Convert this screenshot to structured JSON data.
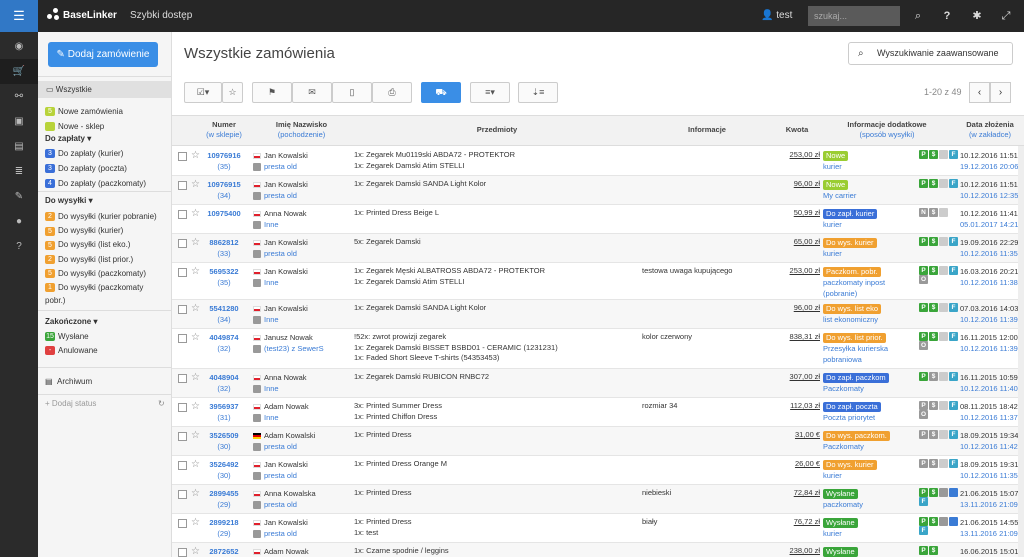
{
  "topbar": {
    "app_name": "BaseLinker",
    "quick_access": "Szybki dostęp",
    "user": "test",
    "search_placeholder": "szukaj...",
    "icons": [
      "search-icon",
      "help-icon",
      "settings-icon",
      "fullscreen-icon",
      "logout-icon"
    ]
  },
  "iconbar": [
    "dashboard-icon",
    "cart-icon",
    "link-icon",
    "storage-icon",
    "store-icon",
    "database-icon",
    "integrations-icon",
    "user-icon",
    "help-icon"
  ],
  "sidebar": {
    "add_button": "Dodaj zamówienie",
    "all": "Wszystkie",
    "group1": [
      {
        "label": "Nowe zamówienia",
        "count": "5",
        "color": "#b8d33a"
      },
      {
        "label": "Nowe - sklep",
        "count": "",
        "color": "#b8d33a"
      }
    ],
    "group_pay": {
      "title": "Do zapłaty ▾",
      "items": [
        {
          "label": "Do zapłaty (kurier)",
          "count": "3",
          "color": "#3a6fd8"
        },
        {
          "label": "Do zapłaty (poczta)",
          "count": "3",
          "color": "#3a6fd8"
        },
        {
          "label": "Do zapłaty (paczkomaty)",
          "count": "4",
          "color": "#3a6fd8"
        }
      ]
    },
    "group_ship": {
      "title": "Do wysyłki ▾",
      "items": [
        {
          "label": "Do wysyłki (kurier pobranie)",
          "count": "2",
          "color": "#f0a030"
        },
        {
          "label": "Do wysyłki (kurier)",
          "count": "5",
          "color": "#f0a030"
        },
        {
          "label": "Do wysyłki (list eko.)",
          "count": "5",
          "color": "#f0a030"
        },
        {
          "label": "Do wysyłki (list prior.)",
          "count": "2",
          "color": "#f0a030"
        },
        {
          "label": "Do wysyłki (paczkomaty)",
          "count": "5",
          "color": "#f0a030"
        },
        {
          "label": "Do wysyłki (paczkomaty",
          "label2": "pobr.)",
          "count": "1",
          "color": "#f0a030"
        }
      ]
    },
    "group_done": {
      "title": "Zakończone ▾",
      "items": [
        {
          "label": "Wysłane",
          "count": "15",
          "color": "#3aa53a"
        },
        {
          "label": "Anulowane",
          "count": "-",
          "color": "#e04040"
        }
      ]
    },
    "archive": "Archiwum",
    "add_status": "+ Dodaj status"
  },
  "main": {
    "title": "Wszystkie zamówienia",
    "adv_search": "Wyszukiwanie zaawansowane",
    "pager": "1-20 z 49",
    "columns": {
      "number": "Numer",
      "number_sub": "(w sklepie)",
      "name": "Imię Nazwisko",
      "name_sub": "(pochodzenie)",
      "products": "Przedmioty",
      "info": "Informacje",
      "amount": "Kwota",
      "extra": "Informacje dodatkowe",
      "extra_sub": "(sposób wysyłki)",
      "date": "Data złożenia",
      "date_sub": "(w zakładce)"
    },
    "rows": [
      {
        "id": "10976916",
        "shop_id": "(35)",
        "flag": "pl",
        "name": "Jan Kowalski",
        "source": "presta old",
        "products": [
          "1x: Zegarek Mu0119ski ABDA72 - PROTEKTOR",
          "1x: Zegarek Damski Atim STELLI"
        ],
        "info": "",
        "amount": "253,00 zł",
        "status": "Nowe",
        "status_color": "#9acd32",
        "ship": "kurier",
        "icons": [
          [
            "P",
            "#3aa53a"
          ],
          [
            "$",
            "#3aa53a"
          ],
          [
            "",
            "#ccc"
          ],
          [
            "F",
            "#3aa5c8"
          ]
        ],
        "date1": "10.12.2016 11:51",
        "date2": "19.12.2016 20:06"
      },
      {
        "id": "10976915",
        "shop_id": "(34)",
        "flag": "pl",
        "name": "Jan Kowalski",
        "source": "presta old",
        "products": [
          "1x: Zegarek Damski SANDA Light Kolor"
        ],
        "info": "",
        "amount": "96,00 zł",
        "status": "Nowe",
        "status_color": "#9acd32",
        "ship": "My carrier",
        "icons": [
          [
            "P",
            "#3aa53a"
          ],
          [
            "$",
            "#3aa53a"
          ],
          [
            "",
            "#ccc"
          ],
          [
            "F",
            "#3aa5c8"
          ]
        ],
        "date1": "10.12.2016 11:51",
        "date2": "10.12.2016 12:35"
      },
      {
        "id": "10975400",
        "shop_id": "",
        "flag": "pl",
        "name": "Anna Nowak",
        "source": "Inne",
        "products": [
          "1x: Printed Dress Beige L"
        ],
        "info": "",
        "amount": "50,99 zł",
        "status": "Do zapł. kurier",
        "status_color": "#3a6fd8",
        "ship": "kurier",
        "icons": [
          [
            "N",
            "#999"
          ],
          [
            "$",
            "#999"
          ],
          [
            "",
            "#ccc"
          ]
        ],
        "date1": "10.12.2016 11:41",
        "date2": "05.01.2017 14:21"
      },
      {
        "id": "8862812",
        "shop_id": "(33)",
        "flag": "pl",
        "name": "Jan Kowalski",
        "source": "presta old",
        "products": [
          "5x: Zegarek Damski"
        ],
        "info": "",
        "amount": "65,00 zł",
        "status": "Do wys. kurier",
        "status_color": "#f0a030",
        "ship": "kurier",
        "icons": [
          [
            "P",
            "#3aa53a"
          ],
          [
            "$",
            "#3aa53a"
          ],
          [
            "",
            "#ccc"
          ],
          [
            "F",
            "#3aa5c8"
          ]
        ],
        "date1": "19.09.2016 22:29",
        "date2": "10.12.2016 11:35"
      },
      {
        "id": "5695322",
        "shop_id": "(35)",
        "flag": "pl",
        "name": "Jan Kowalski",
        "source": "Inne",
        "products": [
          "1x: Zegarek Męski ALBATROSS ABDA72 - PROTEKTOR",
          "1x: Zegarek Damski Atim STELLI"
        ],
        "info": "testowa uwaga kupującego",
        "amount": "253,00 zł",
        "status": "Paczkom. pobr.",
        "status_color": "#f0a030",
        "ship": "paczkomaty inpost",
        "ship2": "(pobranie)",
        "icons": [
          [
            "P",
            "#3aa53a"
          ],
          [
            "$",
            "#3aa53a"
          ],
          [
            "",
            "#ccc"
          ],
          [
            "F",
            "#3aa5c8"
          ],
          [
            "O",
            "#999"
          ]
        ],
        "date1": "16.03.2016 20:21",
        "date2": "10.12.2016 11:38"
      },
      {
        "id": "5541280",
        "shop_id": "(34)",
        "flag": "pl",
        "name": "Jan Kowalski",
        "source": "Inne",
        "products": [
          "1x: Zegarek Damski SANDA Light Kolor"
        ],
        "info": "",
        "amount": "96,00 zł",
        "status": "Do wys. list eko",
        "status_color": "#f0a030",
        "ship": "list ekonomiczny",
        "icons": [
          [
            "P",
            "#3aa53a"
          ],
          [
            "$",
            "#3aa53a"
          ],
          [
            "",
            "#ccc"
          ],
          [
            "F",
            "#3aa5c8"
          ]
        ],
        "date1": "07.03.2016 14:03",
        "date2": "10.12.2016 11:39"
      },
      {
        "id": "4049874",
        "shop_id": "(32)",
        "flag": "pl",
        "name": "Janusz Nowak",
        "source": "(test23) z SewerS",
        "products": [
          "!52x: zwrot prowizji zegarek",
          "1x: Zegarek Damski BISSET BSBD01 - CERAMIC (1231231)",
          "1x: Faded Short Sleeve T-shirts (54353453)"
        ],
        "info": "kolor czerwony",
        "amount": "838,31 zł",
        "status": "Do wys. list prior.",
        "status_color": "#f0a030",
        "ship": "Przesyłka kurierska",
        "ship2": "pobraniowa",
        "icons": [
          [
            "P",
            "#3aa53a"
          ],
          [
            "$",
            "#3aa53a"
          ],
          [
            "",
            "#ccc"
          ],
          [
            "F",
            "#3aa5c8"
          ],
          [
            "O",
            "#999"
          ]
        ],
        "date1": "16.11.2015 12:00",
        "date2": "10.12.2016 11:39"
      },
      {
        "id": "4048904",
        "shop_id": "(32)",
        "flag": "pl",
        "name": "Anna Nowak",
        "source": "Inne",
        "products": [
          "1x: Zegarek Damski RUBICON RNBC72"
        ],
        "info": "",
        "amount": "307,00 zł",
        "status": "Do zapł. paczkom",
        "status_color": "#3a6fd8",
        "ship": "Paczkomaty",
        "icons": [
          [
            "P",
            "#3aa53a"
          ],
          [
            "$",
            "#999"
          ],
          [
            "",
            "#ccc"
          ],
          [
            "F",
            "#3aa5c8"
          ]
        ],
        "date1": "16.11.2015 10:59",
        "date2": "10.12.2016 11:40"
      },
      {
        "id": "3956937",
        "shop_id": "(31)",
        "flag": "pl",
        "name": "Adam Nowak",
        "source": "Inne",
        "products": [
          "3x: Printed Summer Dress",
          "1x: Printed Chiffon Dress"
        ],
        "info": "rozmiar 34",
        "amount": "112,03 zł",
        "status": "Do zapł. poczta",
        "status_color": "#3a6fd8",
        "ship": "Poczta priorytet",
        "icons": [
          [
            "P",
            "#999"
          ],
          [
            "$",
            "#999"
          ],
          [
            "",
            "#ccc"
          ],
          [
            "F",
            "#3aa5c8"
          ],
          [
            "O",
            "#999"
          ]
        ],
        "date1": "08.11.2015 18:42",
        "date2": "10.12.2016 11:37"
      },
      {
        "id": "3526509",
        "shop_id": "(30)",
        "flag": "de",
        "name": "Adam Kowalski",
        "source": "presta old",
        "products": [
          "1x: Printed Dress"
        ],
        "info": "",
        "amount": "31,00 €",
        "status": "Do wys. paczkom.",
        "status_color": "#f0a030",
        "ship": "Paczkomaty",
        "icons": [
          [
            "P",
            "#999"
          ],
          [
            "$",
            "#999"
          ],
          [
            "",
            "#ccc"
          ],
          [
            "F",
            "#3aa5c8"
          ]
        ],
        "date1": "18.09.2015 19:34",
        "date2": "10.12.2016 11:42"
      },
      {
        "id": "3526492",
        "shop_id": "(30)",
        "flag": "pl",
        "name": "Jan Kowalski",
        "source": "presta old",
        "products": [
          "1x: Printed Dress Orange M"
        ],
        "info": "",
        "amount": "26,00 €",
        "status": "Do wys. kurier",
        "status_color": "#f0a030",
        "ship": "kurier",
        "icons": [
          [
            "P",
            "#999"
          ],
          [
            "$",
            "#999"
          ],
          [
            "",
            "#ccc"
          ],
          [
            "F",
            "#3aa5c8"
          ]
        ],
        "date1": "18.09.2015 19:31",
        "date2": "10.12.2016 11:35"
      },
      {
        "id": "2899455",
        "shop_id": "(29)",
        "flag": "pl",
        "name": "Anna Kowalska",
        "source": "presta old",
        "products": [
          "1x: Printed Dress"
        ],
        "info": "niebieski",
        "amount": "72,84 zł",
        "status": "Wysłane",
        "status_color": "#3aa53a",
        "ship": "paczkomaty",
        "icons": [
          [
            "P",
            "#3aa53a"
          ],
          [
            "$",
            "#3aa53a"
          ],
          [
            "",
            "#999"
          ],
          [
            "",
            "#3a7bd5"
          ],
          [
            "F",
            "#3aa5c8"
          ]
        ],
        "date1": "21.06.2015 15:07",
        "date2": "13.11.2016 21:09"
      },
      {
        "id": "2899218",
        "shop_id": "(29)",
        "flag": "pl",
        "name": "Jan Kowalski",
        "source": "presta old",
        "products": [
          "1x: Printed Dress",
          "1x: test"
        ],
        "info": "biały",
        "amount": "76,72 zł",
        "status": "Wysłane",
        "status_color": "#3aa53a",
        "ship": "kurier",
        "icons": [
          [
            "P",
            "#3aa53a"
          ],
          [
            "$",
            "#3aa53a"
          ],
          [
            "",
            "#999"
          ],
          [
            "",
            "#3a7bd5"
          ],
          [
            "F",
            "#3aa5c8"
          ]
        ],
        "date1": "21.06.2015 14:55",
        "date2": "13.11.2016 21:09"
      },
      {
        "id": "2872652",
        "shop_id": "",
        "flag": "pl",
        "name": "Adam Nowak",
        "source": "",
        "products": [
          "1x: Czarne spodnie / leggins"
        ],
        "info": "",
        "amount": "238,00 zł",
        "status": "Wysłane",
        "status_color": "#3aa53a",
        "ship": "",
        "icons": [
          [
            "P",
            "#3aa53a"
          ],
          [
            "$",
            "#3aa53a"
          ]
        ],
        "date1": "16.06.2015 15:01",
        "date2": ""
      }
    ]
  }
}
